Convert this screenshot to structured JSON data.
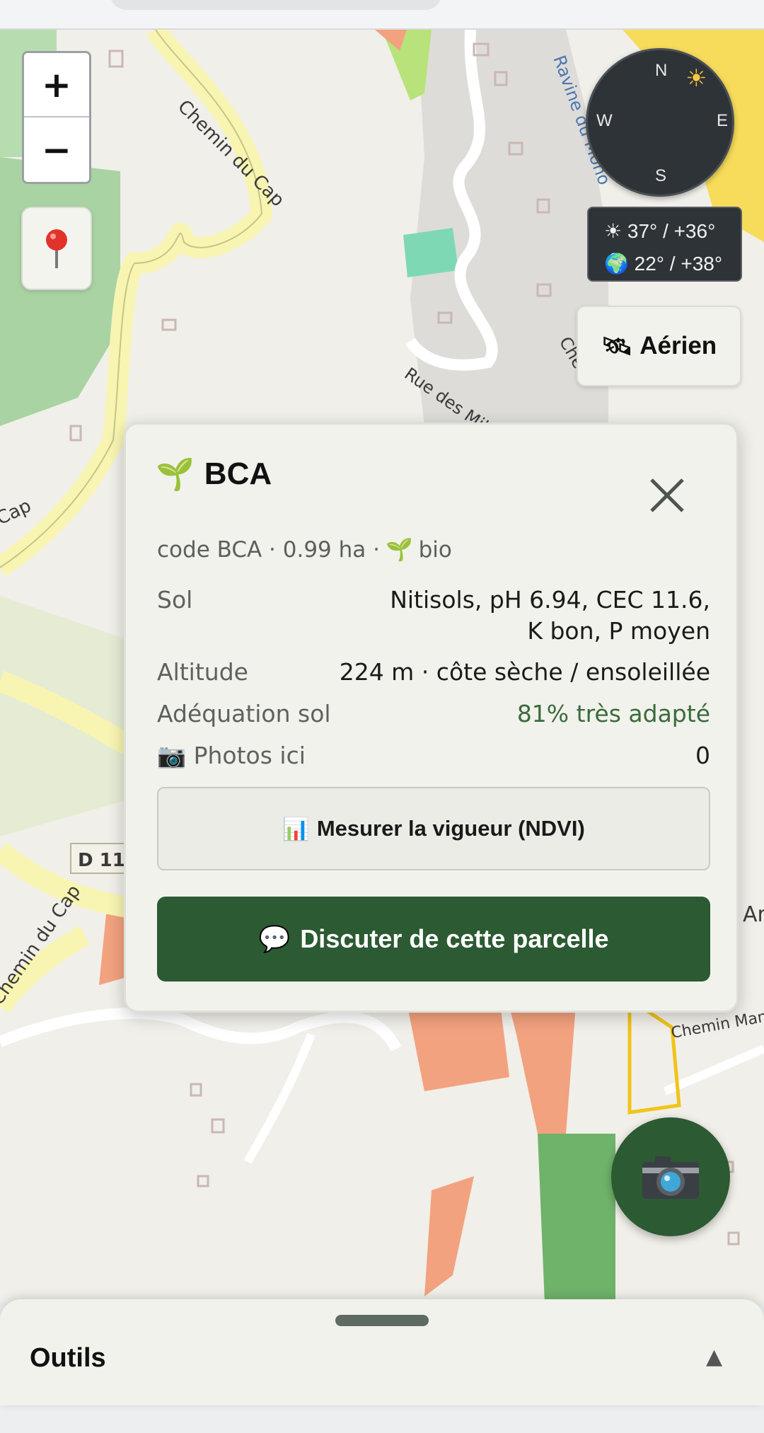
{
  "map": {
    "street_labels": [
      "Chemin du Cap",
      "Rue des Mille",
      "Che",
      "Man",
      "Chemin du Cap",
      "Cap",
      "D 11",
      "Chemin Man",
      "Ravine du Mono",
      "Ar"
    ]
  },
  "controls": {
    "zoom_in": "+",
    "zoom_out": "−",
    "locate_icon": "pin-icon"
  },
  "compass": {
    "n": "N",
    "e": "E",
    "s": "S",
    "w": "W",
    "sun_icon": "☀"
  },
  "temps": {
    "sun_icon": "☀",
    "line1": "37° / +36°",
    "earth_icon": "🌍",
    "line2": "22° / +38°"
  },
  "aerial_button": {
    "icon": "🛰",
    "label": "Aérien"
  },
  "parcel_card": {
    "title_icon": "🌱",
    "title": "BCA",
    "meta_prefix": "code BCA · 0.99 ha ·",
    "meta_icon": "🌱",
    "meta_suffix": "bio",
    "rows": [
      {
        "label": "Sol",
        "value_line1": "Nitisols, pH 6.94, CEC 11.6,",
        "value_line2": "K bon, P moyen"
      },
      {
        "label": "Altitude",
        "value": "224 m · côte sèche / ensoleillée"
      },
      {
        "label": "Adéquation sol",
        "value": "81% très adapté"
      },
      {
        "label_icon": "📷",
        "label": "Photos ici",
        "value": "0"
      }
    ],
    "ndvi_icon": "📊",
    "ndvi_button": "Mesurer la vigueur (NDVI)",
    "chat_icon": "💬",
    "chat_button": "Discuter de cette parcelle"
  },
  "fab": {
    "icon": "camera-icon"
  },
  "bottom_sheet": {
    "title": "Outils",
    "toggle": "▲"
  },
  "colors": {
    "primary_green": "#2c5a32",
    "suitability_green": "#3b6b3d",
    "card_bg": "#f2f2ec",
    "map_bg": "#f1efe9"
  }
}
